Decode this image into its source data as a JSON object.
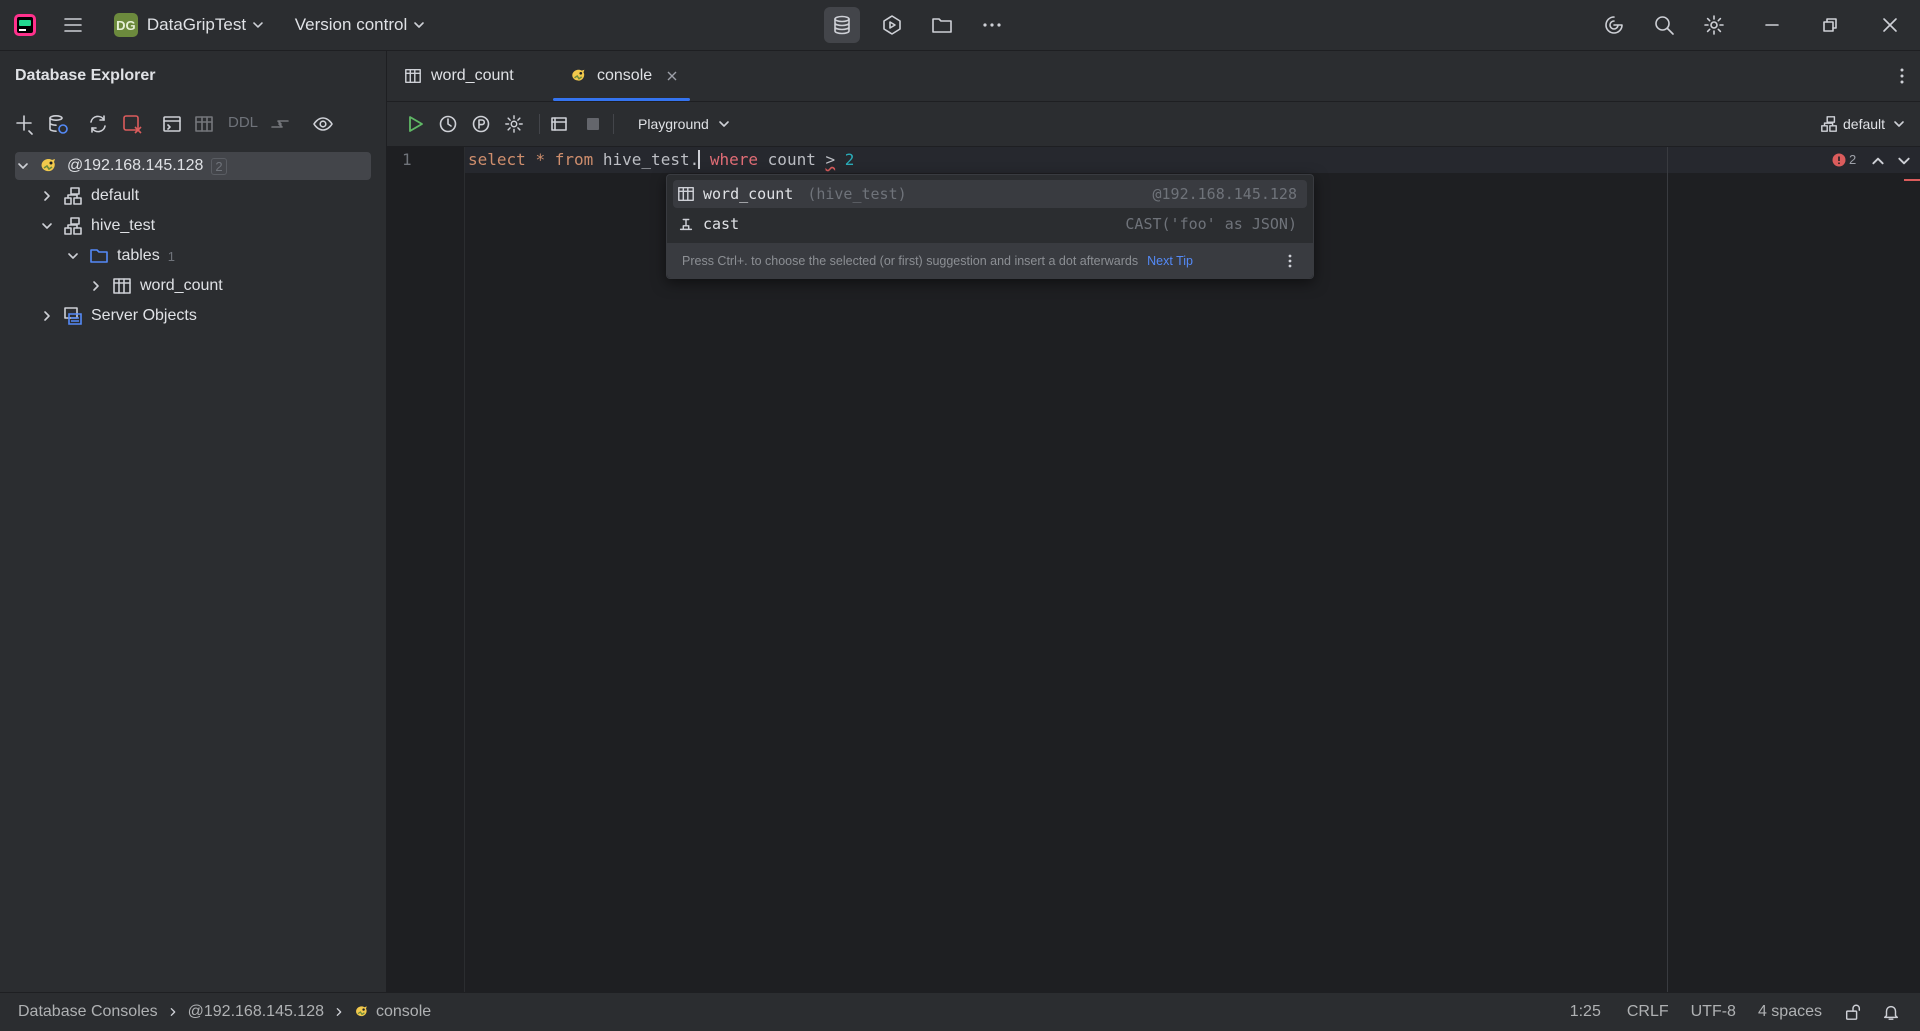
{
  "titlebar": {
    "project_badge": "DG",
    "project_name": "DataGripTest",
    "vcs_label": "Version control"
  },
  "explorer": {
    "title": "Database Explorer",
    "ddl_label": "DDL",
    "tree": {
      "root_label": "@192.168.145.128",
      "root_count": "2",
      "default_label": "default",
      "hive_label": "hive_test",
      "tables_label": "tables",
      "tables_count": "1",
      "table_label": "word_count",
      "server_objects_label": "Server Objects"
    }
  },
  "tabs": {
    "tab1_label": "word_count",
    "tab2_label": "console"
  },
  "editor_toolbar": {
    "mode_label": "Playground",
    "schema_label": "default"
  },
  "editor": {
    "line_number": "1",
    "code": {
      "t1": "select",
      "t2": "*",
      "t3": "from",
      "t4": "hive_test.",
      "t5": "where",
      "t6": "count",
      "t7": ">",
      "t8": "2"
    },
    "error_count": "2"
  },
  "completion": {
    "item1_name": "word_count",
    "item1_hint": "(hive_test)",
    "item1_right": "@192.168.145.128",
    "item2_name": "cast",
    "item2_right": "CAST('foo' as JSON)",
    "footer_text": "Press Ctrl+. to choose the selected (or first) suggestion and insert a dot afterwards",
    "next_tip": "Next Tip"
  },
  "statusbar": {
    "crumb1": "Database Consoles",
    "crumb2": "@192.168.145.128",
    "crumb3": "console",
    "position": "1:25",
    "line_sep": "CRLF",
    "encoding": "UTF-8",
    "indent": "4 spaces"
  },
  "colors": {
    "accent": "#3574f0",
    "keyword": "#cf8e6d",
    "number": "#2aacb8",
    "error": "#db5c5c",
    "hive_icon": "#f2c94c"
  }
}
